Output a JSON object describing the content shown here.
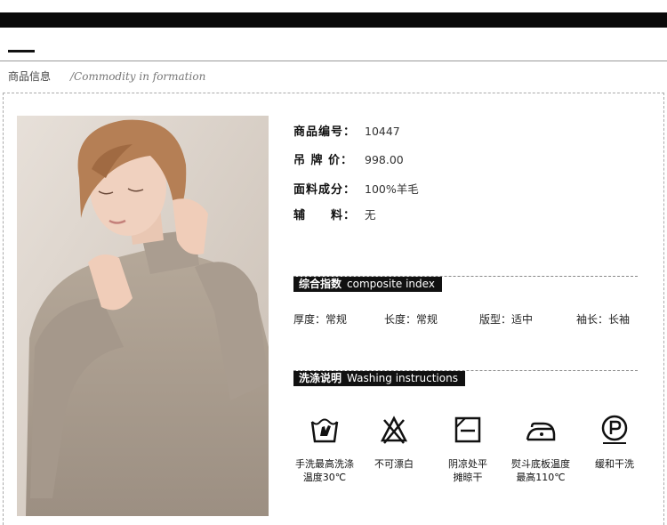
{
  "header": {
    "title": "商品信息",
    "subtitle": "/Commodity in formation"
  },
  "info": [
    {
      "label": "商品编号：",
      "value": "10447"
    },
    {
      "label": "吊 牌 价：",
      "value": "998.00"
    },
    {
      "label": "面料成分：",
      "value": "100%羊毛"
    },
    {
      "label": "辅　　料：",
      "value": "无"
    }
  ],
  "composite": {
    "title_cn": "综合指数",
    "title_en": "composite index",
    "specs": [
      {
        "label": "厚度：",
        "value": "常规"
      },
      {
        "label": "长度：",
        "value": "常规"
      },
      {
        "label": "版型：",
        "value": "适中"
      },
      {
        "label": "袖长：",
        "value": "长袖"
      }
    ]
  },
  "washing": {
    "title_cn": "洗涤说明",
    "title_en": "Washing instructions",
    "items": [
      {
        "icon": "hand-wash-icon",
        "label": "手洗最高洗涤\n温度30℃"
      },
      {
        "icon": "no-bleach-icon",
        "label": "不可漂白"
      },
      {
        "icon": "shade-dry-flat-icon",
        "label": "阴凉处平\n摊晾干"
      },
      {
        "icon": "iron-110-icon",
        "label": "熨斗底板温度\n最高110℃"
      },
      {
        "icon": "gentle-dry-clean-icon",
        "label": "缓和干洗"
      }
    ]
  },
  "colors": {
    "bar": "#0a0a0a",
    "sweater": "#a89b8e",
    "background": "#d8cfc6"
  }
}
